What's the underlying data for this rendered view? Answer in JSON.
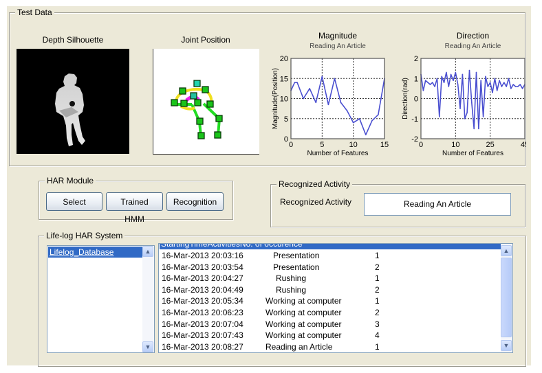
{
  "test_data": {
    "title": "Test Data",
    "silhouette_caption": "Depth Silhouette",
    "joint_caption": "Joint Position"
  },
  "chart_data": [
    {
      "type": "line",
      "title": "Magnitude",
      "subtitle": "Reading An Article",
      "xlabel": "Number of Features",
      "ylabel": "Magnitude(Position)",
      "xlim": [
        0,
        15
      ],
      "ylim": [
        0,
        20
      ],
      "xticks": [
        0,
        5,
        10,
        15
      ],
      "xtick_labels": [
        "0",
        "5",
        "10",
        "15"
      ],
      "yticks": [
        0,
        5,
        10,
        15,
        20
      ],
      "ytick_labels": [
        "0",
        "5",
        "10",
        "15",
        "20"
      ],
      "grid": true,
      "series": [
        {
          "name": "Magnitude",
          "color": "#4a4fd0",
          "x": [
            0,
            0.6,
            1,
            2,
            3,
            4,
            5,
            6,
            7,
            8,
            9,
            10,
            11,
            12,
            13,
            14,
            15
          ],
          "y": [
            12,
            14,
            14,
            10,
            12.5,
            9,
            15.5,
            8.5,
            15,
            9,
            7,
            4,
            5,
            1,
            4.5,
            6,
            15
          ]
        }
      ]
    },
    {
      "type": "line",
      "title": "Direction",
      "subtitle": "Reading An Article",
      "xlabel": "Number of Features",
      "ylabel": "Direction(rad)",
      "xlim": [
        0,
        45
      ],
      "ylim": [
        -2,
        2
      ],
      "xticks": [
        0,
        15,
        30,
        45
      ],
      "xtick_labels": [
        "0",
        "10",
        "25",
        "45"
      ],
      "yticks": [
        -2,
        -1,
        0,
        1,
        2
      ],
      "ytick_labels": [
        "-2",
        "-1",
        "0",
        "1",
        "2"
      ],
      "grid": true,
      "series": [
        {
          "name": "Direction",
          "color": "#4a4fd0",
          "x": [
            0,
            1,
            2,
            3,
            4,
            5,
            6,
            7,
            8,
            9,
            10,
            11,
            12,
            13,
            14,
            15,
            16,
            17,
            18,
            19,
            20,
            21,
            22,
            23,
            24,
            25,
            26,
            27,
            28,
            29,
            30,
            31,
            32,
            33,
            34,
            35,
            36,
            37,
            38,
            39,
            40,
            41,
            42,
            43,
            44,
            45
          ],
          "y": [
            1.2,
            0.4,
            0.9,
            0.8,
            0.7,
            0.8,
            0.6,
            1.0,
            -0.9,
            1.1,
            0.8,
            1.3,
            0.6,
            1.2,
            0.9,
            1.3,
            0.7,
            -0.5,
            1.2,
            -1.0,
            -0.7,
            1.4,
            -0.2,
            -1.5,
            1.3,
            -1.5,
            0.9,
            -0.9,
            1.1,
            0.6,
            0.8,
            0.3,
            1.0,
            0.4,
            0.9,
            0.6,
            0.8,
            0.6,
            1.0,
            0.5,
            0.7,
            0.6,
            0.6,
            0.7,
            0.5,
            0.7
          ]
        }
      ]
    }
  ],
  "har_module": {
    "title": "HAR Module",
    "buttons": [
      "Select",
      "Trained HMM",
      "Recognition"
    ]
  },
  "recognized": {
    "title": "Recognized Activity",
    "label": "Recognized Activity",
    "value": "Reading An Article"
  },
  "lifelog": {
    "title": "Life-log HAR System",
    "databases": [
      "Lifelog_Database"
    ],
    "header": "StartingTimeActivitiesNo. of occurence",
    "rows": [
      {
        "time": "16-Mar-2013 20:03:16",
        "activity": "Presentation",
        "count": "1"
      },
      {
        "time": "16-Mar-2013 20:03:54",
        "activity": "Presentation",
        "count": "2"
      },
      {
        "time": "16-Mar-2013 20:04:27",
        "activity": "Rushing",
        "count": "1"
      },
      {
        "time": "16-Mar-2013 20:04:49",
        "activity": "Rushing",
        "count": "2"
      },
      {
        "time": "16-Mar-2013 20:05:34",
        "activity": "Working at computer",
        "count": "1"
      },
      {
        "time": "16-Mar-2013 20:06:23",
        "activity": "Working at computer",
        "count": "2"
      },
      {
        "time": "16-Mar-2013 20:07:04",
        "activity": "Working at computer",
        "count": "3"
      },
      {
        "time": "16-Mar-2013 20:07:43",
        "activity": "Working at computer",
        "count": "4"
      },
      {
        "time": "16-Mar-2013 20:08:27",
        "activity": "Reading an Article",
        "count": "1"
      }
    ]
  },
  "icons": {
    "scroll_up": "▲",
    "scroll_down": "▼"
  }
}
